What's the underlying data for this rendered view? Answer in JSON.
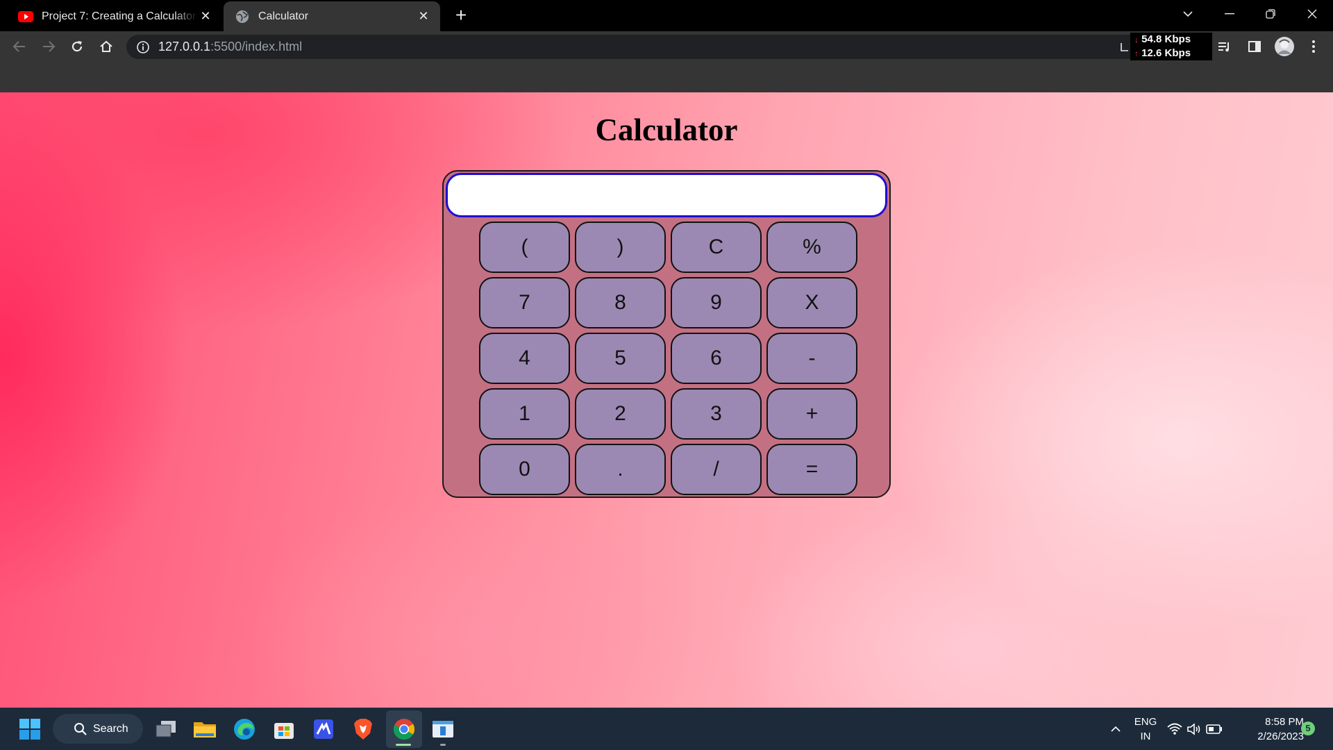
{
  "browser": {
    "tabs": [
      {
        "title": "Project 7: Creating a Calculator u",
        "favicon": "youtube-icon",
        "active": false
      },
      {
        "title": "Calculator",
        "favicon": "globe-icon",
        "active": true
      }
    ],
    "url_host": "127.0.0.1",
    "url_rest": ":5500/index.html",
    "net_down": "54.8 Kbps",
    "net_up": "12.6 Kbps"
  },
  "page": {
    "title": "Calculator",
    "display_value": "",
    "keys": [
      "(",
      ")",
      "C",
      "%",
      "7",
      "8",
      "9",
      "X",
      "4",
      "5",
      "6",
      "-",
      "1",
      "2",
      "3",
      "+",
      "0",
      ".",
      "/",
      "="
    ]
  },
  "taskbar": {
    "search_label": "Search",
    "language_line1": "ENG",
    "language_line2": "IN",
    "time": "8:58 PM",
    "date": "2/26/2023",
    "notification_count": "5"
  },
  "colors": {
    "calc_body": "#c47083",
    "key_fill": "#9c89b3",
    "display_border": "#1d0fd0"
  }
}
